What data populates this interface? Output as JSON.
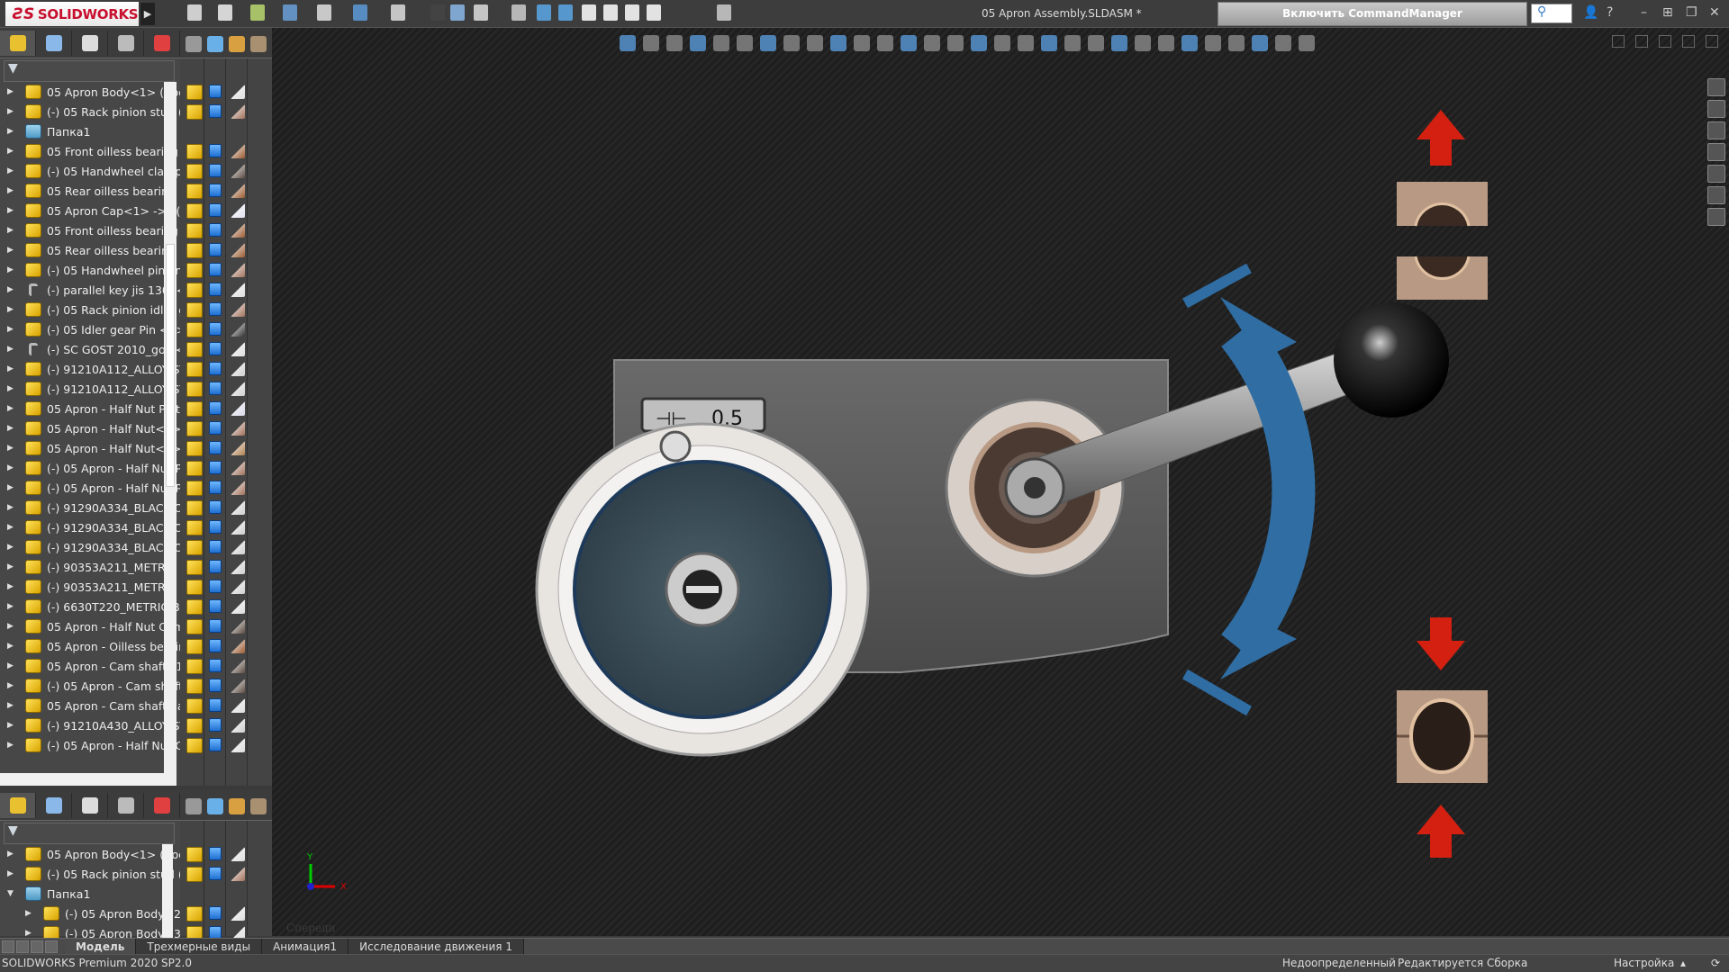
{
  "app": {
    "logo_text": "SOLIDWORKS",
    "document_title": "05 Apron Assembly.SLDASM *",
    "command_manager_button": "Включить CommandManager"
  },
  "colors": {
    "accent_red": "#c8102e",
    "arrow_red": "#d42010",
    "rotation_blue": "#2f6da3",
    "bearing_tan": "#b89a84"
  },
  "toolbar": {
    "icons": [
      "home-icon",
      "new-document-icon",
      "open-icon",
      "save-icon",
      "print-icon",
      "undo-icon",
      "select-icon",
      "rebuild-traffic-light-icon",
      "file-properties-icon",
      "options-gear-icon",
      "sum-icon",
      "measure-icon",
      "mass-properties-icon",
      "layout-1-icon",
      "layout-2-icon",
      "layout-3-icon",
      "layout-4-icon",
      "snapshot-icon"
    ]
  },
  "tree_upper": {
    "rows": [
      {
        "label": "05 Apron Body<1> (Body",
        "type": "part",
        "mat": "#dcdcdc"
      },
      {
        "label": "(-) 05 Rack pinion stud (B",
        "type": "part",
        "mat": "#a0705a"
      },
      {
        "label": "Папка1",
        "type": "folder",
        "mat": ""
      },
      {
        "label": "05 Front oilless bearing h",
        "type": "part",
        "mat": "#9a5a30"
      },
      {
        "label": "(-) 05 Handwheel clamp w",
        "type": "part",
        "mat": "#5a4a40"
      },
      {
        "label": "05 Rear oilless bearing ha",
        "type": "part",
        "mat": "#9a5a30"
      },
      {
        "label": "05 Apron Cap<1> ->? (П",
        "type": "part",
        "mat": "#e0e0f0"
      },
      {
        "label": "05 Front oilless bearing R",
        "type": "part",
        "mat": "#9a5a30"
      },
      {
        "label": "05 Rear oilless bearing Ra",
        "type": "part",
        "mat": "#9a5a30"
      },
      {
        "label": "(-) 05 Handwheel pinion",
        "type": "part",
        "mat": "#a0705a"
      },
      {
        "label": "(-) parallel key jis 1301<1>",
        "type": "bolt",
        "mat": "#dcdcdc"
      },
      {
        "label": "(-) 05 Rack pinion idler ge",
        "type": "part",
        "mat": "#a0705a"
      },
      {
        "label": "(-) 05 Idler gear Pin <1> (",
        "type": "part",
        "mat": "#333333"
      },
      {
        "label": "(-) SC GOST 2010_gost<1",
        "type": "bolt",
        "mat": "#dcdcdc"
      },
      {
        "label": "(-) 91210A112_ALLOY STE",
        "type": "part",
        "mat": "#cfcfcf"
      },
      {
        "label": "(-) 91210A112_ALLOY STE",
        "type": "part",
        "mat": "#cfcfcf"
      },
      {
        "label": "05 Apron - Half Nut Plate",
        "type": "part",
        "mat": "#d8d8e8"
      },
      {
        "label": "05 Apron - Half Nut<1> (",
        "type": "part",
        "mat": "#a0705a"
      },
      {
        "label": "05 Apron - Half Nut<2> (",
        "type": "part",
        "mat": "#b08050"
      },
      {
        "label": "(-) 05 Apron - Half Nut Pl",
        "type": "part",
        "mat": "#a0705a"
      },
      {
        "label": "(-) 05 Apron - Half Nut Pl",
        "type": "part",
        "mat": "#a0705a"
      },
      {
        "label": "(-) 91290A334_BLACK-OX",
        "type": "part",
        "mat": "#cfcfcf"
      },
      {
        "label": "(-) 91290A334_BLACK-OX",
        "type": "part",
        "mat": "#cfcfcf"
      },
      {
        "label": "(-) 91290A334_BLACK-OX",
        "type": "part",
        "mat": "#cfcfcf"
      },
      {
        "label": "(-) 90353A211_METRIC PA",
        "type": "part",
        "mat": "#cfcfcf"
      },
      {
        "label": "(-) 90353A211_METRIC PA",
        "type": "part",
        "mat": "#cfcfcf"
      },
      {
        "label": "(-) 6630T220_METRIC BLA",
        "type": "part",
        "mat": "#dcdcdc"
      },
      {
        "label": "05 Apron - Half Nut Cam",
        "type": "part",
        "mat": "#5a4a40"
      },
      {
        "label": "05 Apron - Oilless bearing",
        "type": "part",
        "mat": "#9a5a30"
      },
      {
        "label": "05 Apron - Cam shaft<1>",
        "type": "part",
        "mat": "#5a4a40"
      },
      {
        "label": "(-) 05 Apron - Cam shaft",
        "type": "part",
        "mat": "#5a4a40"
      },
      {
        "label": "05 Apron - Cam shaft han",
        "type": "part",
        "mat": "#dcdcdc"
      },
      {
        "label": "(-) 91210A430_ALLOY STE",
        "type": "part",
        "mat": "#cfcfcf"
      },
      {
        "label": "(-) 05 Apron - Half Nut C",
        "type": "part",
        "mat": "#dcdcdc"
      }
    ]
  },
  "tree_lower": {
    "rows": [
      {
        "label": "05 Apron Body<1> (Body",
        "type": "part",
        "mat": "#dcdcdc",
        "indent": 0,
        "expanded": false
      },
      {
        "label": "(-) 05 Rack pinion stud (B",
        "type": "part",
        "mat": "#a0705a",
        "indent": 0,
        "expanded": false
      },
      {
        "label": "Папка1",
        "type": "folder",
        "mat": "",
        "indent": 0,
        "expanded": true
      },
      {
        "label": "(-) 05 Apron Body<2",
        "type": "part",
        "mat": "#dcdcdc",
        "indent": 1,
        "expanded": false
      },
      {
        "label": "(-) 05 Apron Body<3",
        "type": "part",
        "mat": "#dcdcdc",
        "indent": 1,
        "expanded": false
      }
    ]
  },
  "model": {
    "dial_label": "0.5",
    "view_orientation": "Спереди",
    "triad": {
      "x": "X",
      "y": "Y"
    }
  },
  "bottom_tabs": [
    {
      "label": "Модель",
      "active": true
    },
    {
      "label": "Трехмерные виды",
      "active": false
    },
    {
      "label": "Анимация1",
      "active": false
    },
    {
      "label": "Исследование движения 1",
      "active": false
    }
  ],
  "status": {
    "version": "SOLIDWORKS Premium 2020 SP2.0",
    "state": "Недоопределенный",
    "mode": "Редактируется Сборка",
    "settings": "Настройка"
  }
}
